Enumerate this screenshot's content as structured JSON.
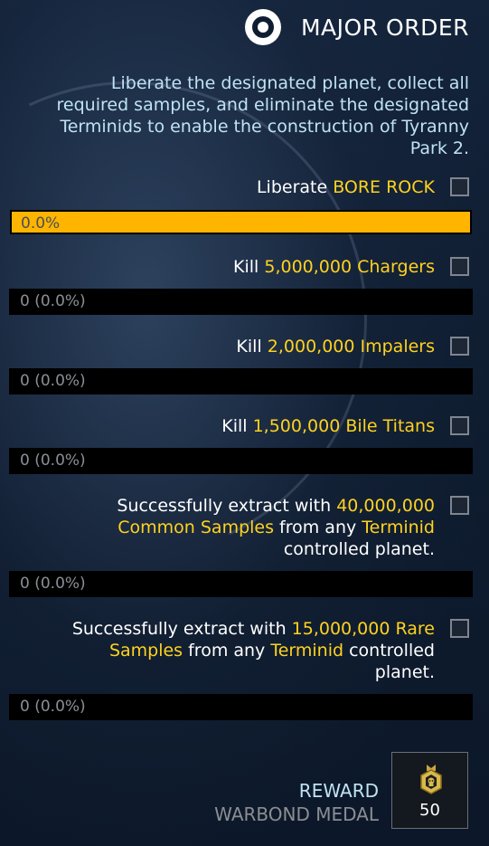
{
  "header": {
    "title": "MAJOR ORDER",
    "icon": "target-icon"
  },
  "description": "Liberate the designated planet, collect all required samples, and eliminate the designated Terminids to enable the construction of Tyranny Park 2.",
  "tasks": [
    {
      "lines": [
        [
          {
            "t": "Liberate ",
            "hl": false
          },
          {
            "t": "BORE ROCK",
            "hl": true
          }
        ]
      ],
      "progress_text": "0.0%",
      "progress": 1.0,
      "active": true
    },
    {
      "lines": [
        [
          {
            "t": "Kill ",
            "hl": false
          },
          {
            "t": "5,000,000 Chargers",
            "hl": true
          }
        ]
      ],
      "progress_text": "0 (0.0%)",
      "progress": 0.0,
      "active": false
    },
    {
      "lines": [
        [
          {
            "t": "Kill ",
            "hl": false
          },
          {
            "t": "2,000,000 Impalers",
            "hl": true
          }
        ]
      ],
      "progress_text": "0 (0.0%)",
      "progress": 0.0,
      "active": false
    },
    {
      "lines": [
        [
          {
            "t": "Kill ",
            "hl": false
          },
          {
            "t": "1,500,000 Bile Titans",
            "hl": true
          }
        ]
      ],
      "progress_text": "0 (0.0%)",
      "progress": 0.0,
      "active": false
    },
    {
      "lines": [
        [
          {
            "t": "Successfully extract with ",
            "hl": false
          },
          {
            "t": "40,000,000",
            "hl": true
          }
        ],
        [
          {
            "t": "Common Samples",
            "hl": true
          },
          {
            "t": " from any ",
            "hl": false
          },
          {
            "t": "Terminid",
            "hl": true
          }
        ],
        [
          {
            "t": "controlled planet.",
            "hl": false
          }
        ]
      ],
      "progress_text": "0 (0.0%)",
      "progress": 0.0,
      "active": false
    },
    {
      "lines": [
        [
          {
            "t": "Successfully extract with ",
            "hl": false
          },
          {
            "t": "15,000,000 Rare",
            "hl": true
          }
        ],
        [
          {
            "t": "Samples",
            "hl": true
          },
          {
            "t": " from any ",
            "hl": false
          },
          {
            "t": "Terminid",
            "hl": true
          },
          {
            "t": " controlled",
            "hl": false
          }
        ],
        [
          {
            "t": "planet.",
            "hl": false
          }
        ]
      ],
      "progress_text": "0 (0.0%)",
      "progress": 0.0,
      "active": false
    }
  ],
  "reward": {
    "label": "REWARD",
    "name": "WARBOND MEDAL",
    "count": "50",
    "icon": "medal-icon"
  },
  "colors": {
    "accent": "#ffd21f",
    "progress_fill": "#ffb400",
    "description": "#bfe3f2"
  }
}
